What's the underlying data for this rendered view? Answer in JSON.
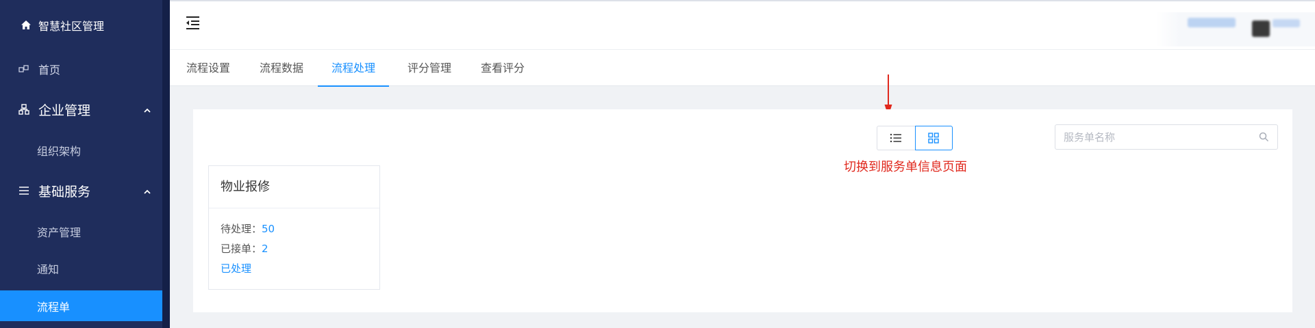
{
  "sidebar": {
    "brand": "智慧社区管理",
    "home_label": "首页",
    "groups": [
      {
        "label": "企业管理",
        "items": [
          "组织架构"
        ]
      },
      {
        "label": "基础服务",
        "items": [
          "资产管理",
          "通知",
          "流程单"
        ]
      }
    ],
    "active_item": "流程单"
  },
  "tabs": [
    {
      "label": "流程设置",
      "active": false
    },
    {
      "label": "流程数据",
      "active": false
    },
    {
      "label": "流程处理",
      "active": true
    },
    {
      "label": "评分管理",
      "active": false
    },
    {
      "label": "查看评分",
      "active": false
    }
  ],
  "toolbar": {
    "view_modes": [
      "list",
      "grid"
    ],
    "selected_view": "grid",
    "search_placeholder": "服务单名称",
    "search_value": ""
  },
  "annotation": {
    "text": "切换到服务单信息页面",
    "color": "#e0281d"
  },
  "cards": [
    {
      "title": "物业报修",
      "pending_label": "待处理：",
      "pending_value": "50",
      "accepted_label": "已接单：",
      "accepted_value": "2",
      "processed_label": "已处理"
    }
  ],
  "colors": {
    "sidebar_bg": "#1f2d5c",
    "accent": "#1890ff",
    "annotation_red": "#e0281d"
  }
}
